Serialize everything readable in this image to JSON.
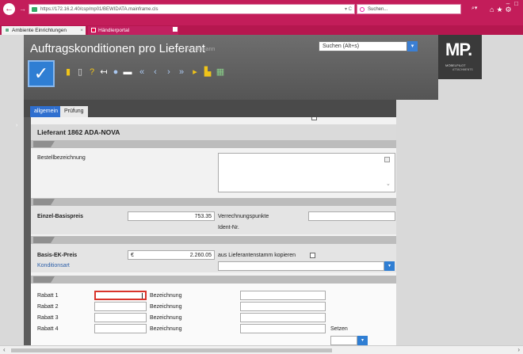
{
  "browser": {
    "url": "https://172.16.2.40/csp/mp01/BEWIDATA.mainframe.cls",
    "url_controls": "▾ C",
    "search_placeholder": "Suchen...",
    "tabs": [
      {
        "label": "Ambiente Einrichtungen"
      },
      {
        "label": "Händlerportal"
      }
    ],
    "tab_close": "×"
  },
  "app": {
    "title": "Auftragskonditionen pro Lieferant",
    "user": "Uli Flottmann",
    "search_value": "Suchen (Alt+s)",
    "logo_text": "MP.",
    "logo_sub": "MÖBELPILOT",
    "logo_sub2": "ATTACHMENTS"
  },
  "tabs": [
    {
      "label": "allgemein",
      "active": true
    },
    {
      "label": "Prüfung",
      "active": false
    }
  ],
  "header": {
    "lieferant_label": "Lieferant",
    "lieferant_nr": "1862",
    "lieferant_name": "ADA-NOVA"
  },
  "fields": {
    "bestellbezeichnung_label": "Bestellbezeichnung",
    "einzel_basispreis_label": "Einzel-Basispreis",
    "einzel_basispreis_value": "753.35",
    "verrechnungspunkte_label": "Verrechnungspunkte",
    "ident_nr_label": "Ident-Nr.",
    "basis_ek_label": "Basis-EK-Preis",
    "basis_ek_currency": "€",
    "basis_ek_value": "2.260.05",
    "kopieren_label": "aus Lieferantenstamm kopieren",
    "konditionsart_label": "Konditionsart",
    "rabatte": [
      {
        "label": "Rabatt 1",
        "bez_label": "Bezeichnung"
      },
      {
        "label": "Rabatt 2",
        "bez_label": "Bezeichnung"
      },
      {
        "label": "Rabatt 3",
        "bez_label": "Bezeichnung"
      },
      {
        "label": "Rabatt 4",
        "bez_label": "Bezeichnung"
      }
    ],
    "setzen_label": "Setzen"
  },
  "colors": {
    "browser_accent": "#c31d5a",
    "primary_blue": "#2f7ed3",
    "focus_red": "#d9342b"
  }
}
